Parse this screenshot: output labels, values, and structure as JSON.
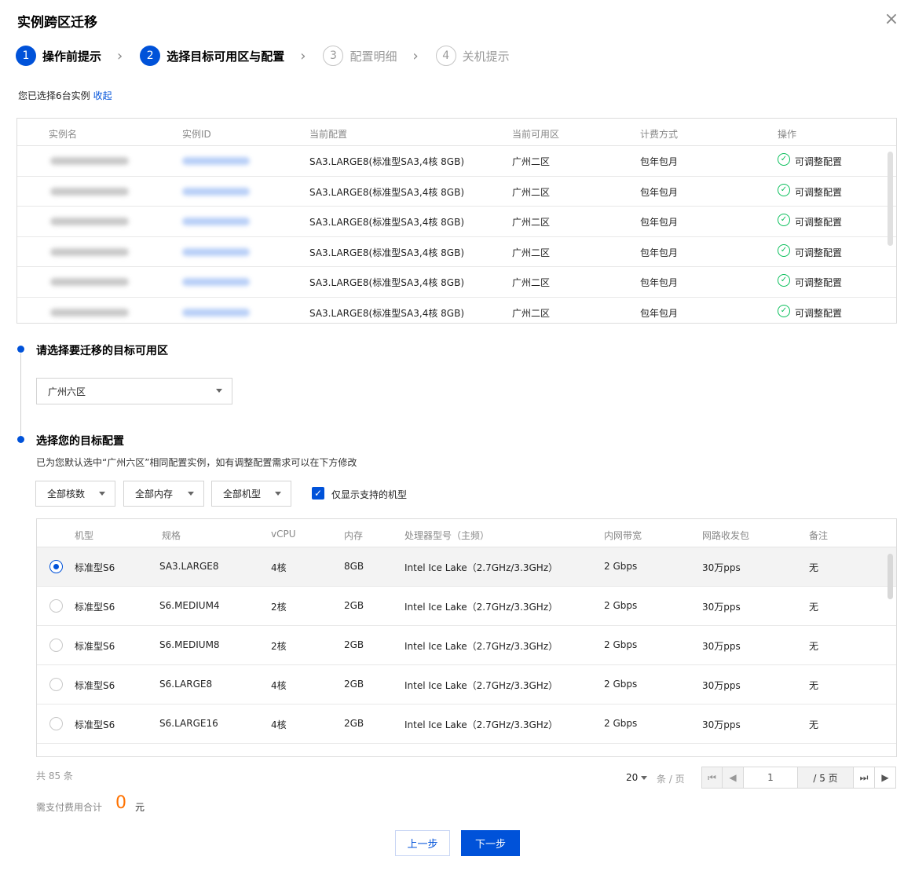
{
  "dialog": {
    "title": "实例跨区迁移"
  },
  "steps": [
    {
      "num": "1",
      "label": "操作前提示"
    },
    {
      "num": "2",
      "label": "选择目标可用区与配置"
    },
    {
      "num": "3",
      "label": "配置明细"
    },
    {
      "num": "4",
      "label": "关机提示"
    }
  ],
  "selection": {
    "text": "您已选择6台实例",
    "collapse_link": "收起"
  },
  "instance_table": {
    "headers": [
      "实例名",
      "实例ID",
      "当前配置",
      "当前可用区",
      "计费方式",
      "操作"
    ],
    "rows": [
      {
        "config": "SA3.LARGE8(标准型SA3,4核 8GB)",
        "zone": "广州二区",
        "billing": "包年包月",
        "action": "可调整配置"
      },
      {
        "config": "SA3.LARGE8(标准型SA3,4核 8GB)",
        "zone": "广州二区",
        "billing": "包年包月",
        "action": "可调整配置"
      },
      {
        "config": "SA3.LARGE8(标准型SA3,4核 8GB)",
        "zone": "广州二区",
        "billing": "包年包月",
        "action": "可调整配置"
      },
      {
        "config": "SA3.LARGE8(标准型SA3,4核 8GB)",
        "zone": "广州二区",
        "billing": "包年包月",
        "action": "可调整配置"
      },
      {
        "config": "SA3.LARGE8(标准型SA3,4核 8GB)",
        "zone": "广州二区",
        "billing": "包年包月",
        "action": "可调整配置"
      },
      {
        "config": "SA3.LARGE8(标准型SA3,4核 8GB)",
        "zone": "广州二区",
        "billing": "包年包月",
        "action": "可调整配置"
      }
    ]
  },
  "target_zone": {
    "title": "请选择要迁移的目标可用区",
    "value": "广州六区"
  },
  "target_config": {
    "title": "选择您的目标配置",
    "description": "已为您默认选中“广州六区”相同配置实例，如有调整配置需求可以在下方修改",
    "filters": {
      "cores": "全部核数",
      "memory": "全部内存",
      "model": "全部机型"
    },
    "only_supported_label": "仅显示支持的机型"
  },
  "config_table": {
    "headers": [
      "机型",
      "规格",
      "vCPU",
      "内存",
      "处理器型号（主频）",
      "内网带宽",
      "网路收发包",
      "备注"
    ],
    "rows": [
      {
        "type": "标准型S6",
        "spec": "SA3.LARGE8",
        "vcpu": "4核",
        "mem": "8GB",
        "cpu": "Intel Ice Lake（2.7GHz/3.3GHz）",
        "bw": "2 Gbps",
        "pps": "30万pps",
        "note": "无"
      },
      {
        "type": "标准型S6",
        "spec": "S6.MEDIUM4",
        "vcpu": "2核",
        "mem": "2GB",
        "cpu": "Intel Ice Lake（2.7GHz/3.3GHz）",
        "bw": "2 Gbps",
        "pps": "30万pps",
        "note": "无"
      },
      {
        "type": "标准型S6",
        "spec": "S6.MEDIUM8",
        "vcpu": "2核",
        "mem": "2GB",
        "cpu": "Intel Ice Lake（2.7GHz/3.3GHz）",
        "bw": "2 Gbps",
        "pps": "30万pps",
        "note": "无"
      },
      {
        "type": "标准型S6",
        "spec": "S6.LARGE8",
        "vcpu": "4核",
        "mem": "2GB",
        "cpu": "Intel Ice Lake（2.7GHz/3.3GHz）",
        "bw": "2 Gbps",
        "pps": "30万pps",
        "note": "无"
      },
      {
        "type": "标准型S6",
        "spec": "S6.LARGE16",
        "vcpu": "4核",
        "mem": "2GB",
        "cpu": "Intel Ice Lake（2.7GHz/3.3GHz）",
        "bw": "2 Gbps",
        "pps": "30万pps",
        "note": "无"
      }
    ]
  },
  "pagination": {
    "total": "共 85 条",
    "page_size": "20",
    "unit": "条 / 页",
    "current": "1",
    "pages": "/ 5 页"
  },
  "fee": {
    "label": "需支付费用合计",
    "value": "0",
    "unit": "元"
  },
  "buttons": {
    "prev": "上一步",
    "next": "下一步"
  },
  "colors": {
    "primary": "#0052d9",
    "success": "#0abf5b",
    "fee": "#ff7200"
  }
}
